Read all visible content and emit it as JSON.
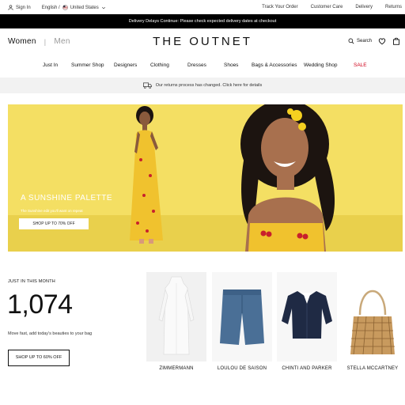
{
  "utility": {
    "sign_in": "Sign In",
    "language": "English /",
    "country": "United States",
    "links": [
      "Track Your Order",
      "Customer Care",
      "Delivery",
      "Returns"
    ]
  },
  "banner": {
    "text": "Delivery Delays Continue: Please check expected delivery dates at checkout"
  },
  "header": {
    "women": "Women",
    "men": "Men",
    "logo": "THE OUTNET",
    "search": "Search"
  },
  "nav": {
    "items": [
      "Just In",
      "Summer Shop",
      "Designers",
      "Clothing",
      "Dresses",
      "Shoes",
      "Bags & Accessories",
      "Wedding Shop",
      "SALE"
    ]
  },
  "returns": {
    "text": "Our returns process has changed. Click here for details"
  },
  "hero": {
    "title": "A SUNSHINE PALETTE",
    "subtitle": "The Sunshine edit you'll want on repeat",
    "button": "SHOP UP TO 70% OFF"
  },
  "just_in": {
    "label": "JUST IN THIS MONTH",
    "count": "1,074",
    "subtitle": "Move fast, add today's beauties to your bag",
    "button": "SHOP UP TO 60% OFF"
  },
  "products": [
    {
      "brand": "ZIMMERMANN",
      "icon": "white-dress-image"
    },
    {
      "brand": "LOULOU DE SAISON",
      "icon": "denim-shorts-image"
    },
    {
      "brand": "CHINTI AND PARKER",
      "icon": "navy-cardigan-image"
    },
    {
      "brand": "STELLA MCCARTNEY",
      "icon": "chain-bag-image"
    }
  ],
  "colors": {
    "accent": "#000000",
    "sale": "#d0021b",
    "hero_bg": "#f4df63",
    "dress": "#f0c22e",
    "cherry": "#c8202c"
  }
}
